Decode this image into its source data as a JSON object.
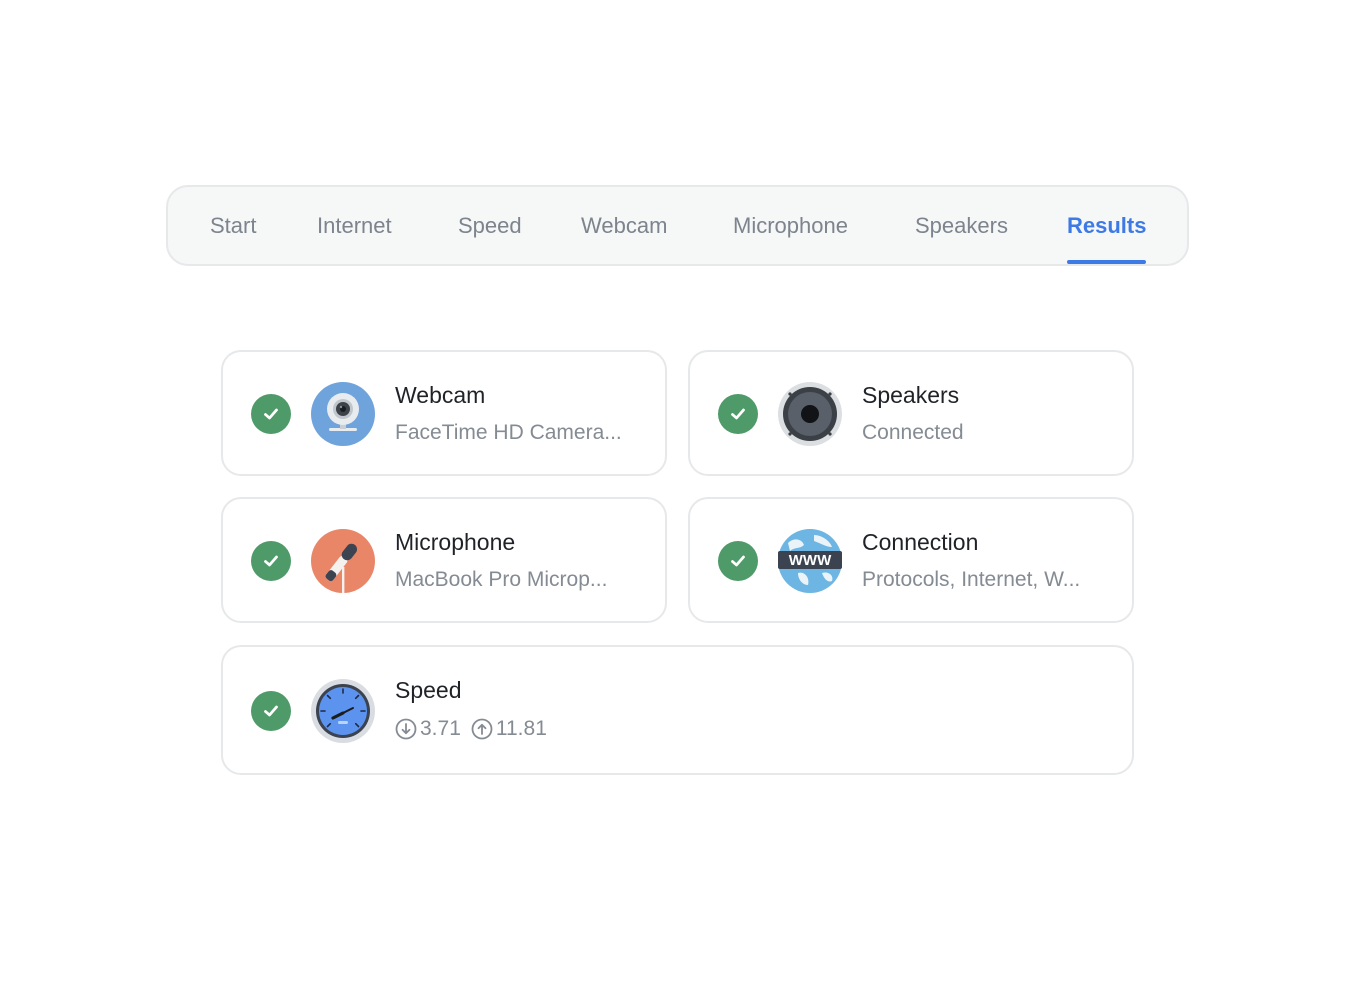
{
  "tabs": [
    {
      "label": "Start",
      "active": false
    },
    {
      "label": "Internet",
      "active": false
    },
    {
      "label": "Speed",
      "active": false
    },
    {
      "label": "Webcam",
      "active": false
    },
    {
      "label": "Microphone",
      "active": false
    },
    {
      "label": "Speakers",
      "active": false
    },
    {
      "label": "Results",
      "active": true
    }
  ],
  "results": {
    "webcam": {
      "title": "Webcam",
      "subtitle": "FaceTime HD Camera...",
      "status": "passed",
      "icon": "webcam-icon"
    },
    "speakers": {
      "title": "Speakers",
      "subtitle": "Connected",
      "status": "passed",
      "icon": "speaker-icon"
    },
    "microphone": {
      "title": "Microphone",
      "subtitle": "MacBook Pro Microp...",
      "status": "passed",
      "icon": "microphone-icon"
    },
    "connection": {
      "title": "Connection",
      "subtitle": "Protocols, Internet, W...",
      "status": "passed",
      "icon": "globe-www-icon"
    },
    "speed": {
      "title": "Speed",
      "download": "3.71",
      "upload": "11.81",
      "status": "passed",
      "icon": "speedometer-icon"
    }
  },
  "colors": {
    "accent": "#3d7ae6",
    "success": "#4e9a68",
    "muted_text": "#858b93",
    "border": "#e6e8ea"
  }
}
